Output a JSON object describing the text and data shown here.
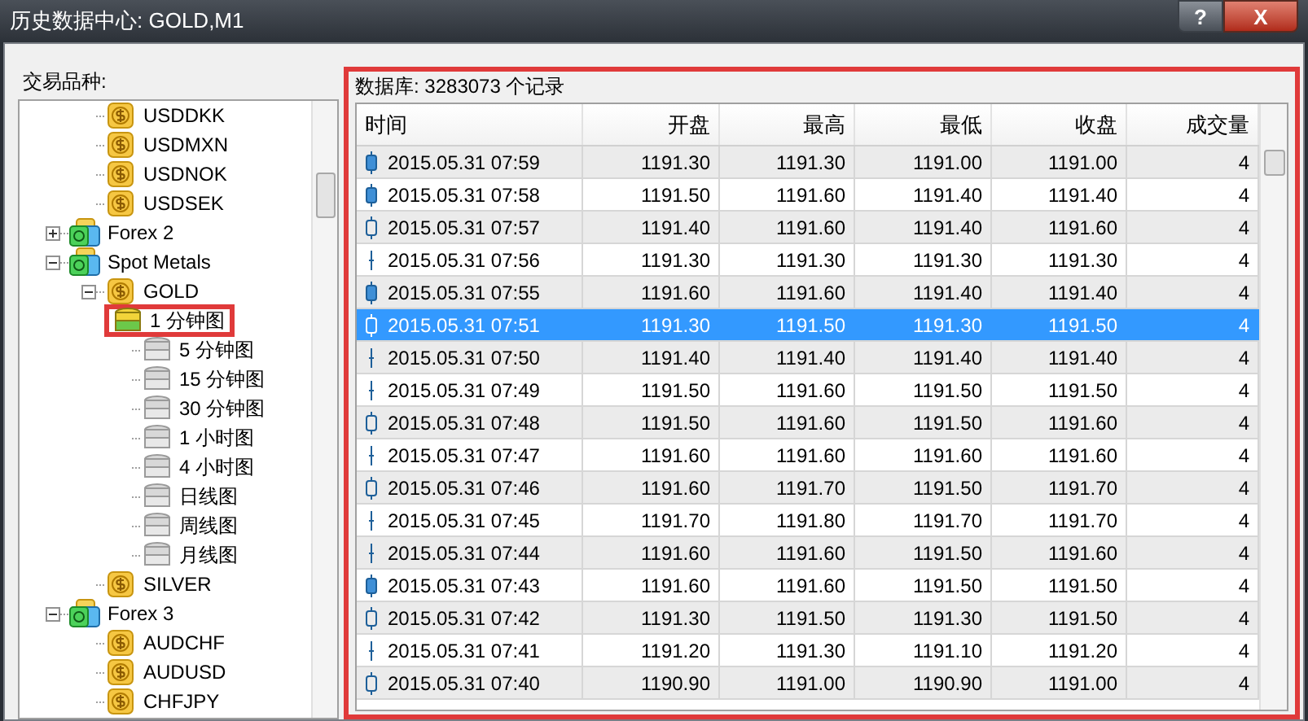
{
  "window": {
    "title": "历史数据中心: GOLD,M1",
    "buttons": [
      "?",
      "X"
    ]
  },
  "tree": {
    "label": "交易品种:",
    "continued_children": [
      {
        "kind": "symbol",
        "label": "USDDKK"
      },
      {
        "kind": "symbol",
        "label": "USDMXN"
      },
      {
        "kind": "symbol",
        "label": "USDNOK"
      },
      {
        "kind": "symbol",
        "label": "USDSEK"
      }
    ],
    "items": [
      {
        "kind": "group",
        "label": "Forex 2",
        "expanded": false
      },
      {
        "kind": "group",
        "label": "Spot Metals",
        "expanded": true,
        "children": [
          {
            "kind": "symbol",
            "label": "GOLD",
            "expanded": true,
            "children": [
              {
                "kind": "timeframe",
                "label": "1 分钟图",
                "selected": true,
                "annotated": true
              },
              {
                "kind": "timeframe",
                "label": "5 分钟图",
                "selected": false,
                "annotated": false
              },
              {
                "kind": "timeframe",
                "label": "15 分钟图",
                "selected": false,
                "annotated": false
              },
              {
                "kind": "timeframe",
                "label": "30 分钟图",
                "selected": false,
                "annotated": false
              },
              {
                "kind": "timeframe",
                "label": "1 小时图",
                "selected": false,
                "annotated": false
              },
              {
                "kind": "timeframe",
                "label": "4 小时图",
                "selected": false,
                "annotated": false
              },
              {
                "kind": "timeframe",
                "label": "日线图",
                "selected": false,
                "annotated": false
              },
              {
                "kind": "timeframe",
                "label": "周线图",
                "selected": false,
                "annotated": false
              },
              {
                "kind": "timeframe",
                "label": "月线图",
                "selected": false,
                "annotated": false
              }
            ]
          },
          {
            "kind": "symbol",
            "label": "SILVER"
          }
        ]
      },
      {
        "kind": "group",
        "label": "Forex 3",
        "expanded": true,
        "children": [
          {
            "kind": "symbol",
            "label": "AUDCHF"
          },
          {
            "kind": "symbol",
            "label": "AUDUSD"
          },
          {
            "kind": "symbol",
            "label": "CHFJPY"
          }
        ]
      }
    ]
  },
  "data_panel": {
    "annotated": true,
    "record_count": "数据库: 3283073 个记录",
    "columns": [
      "时间",
      "开盘",
      "最高",
      "最低",
      "收盘",
      "成交量"
    ],
    "rows": [
      {
        "kind": "bear",
        "selected": false,
        "cells": [
          "2015.05.31 07:59",
          "1191.30",
          "1191.30",
          "1191.00",
          "1191.00",
          "4"
        ]
      },
      {
        "kind": "bear",
        "selected": false,
        "cells": [
          "2015.05.31 07:58",
          "1191.50",
          "1191.60",
          "1191.40",
          "1191.40",
          "4"
        ]
      },
      {
        "kind": "bull",
        "selected": false,
        "cells": [
          "2015.05.31 07:57",
          "1191.40",
          "1191.60",
          "1191.40",
          "1191.60",
          "4"
        ]
      },
      {
        "kind": "doji",
        "selected": false,
        "cells": [
          "2015.05.31 07:56",
          "1191.30",
          "1191.30",
          "1191.30",
          "1191.30",
          "4"
        ]
      },
      {
        "kind": "bear",
        "selected": false,
        "cells": [
          "2015.05.31 07:55",
          "1191.60",
          "1191.60",
          "1191.40",
          "1191.40",
          "4"
        ]
      },
      {
        "kind": "bull",
        "selected": true,
        "cells": [
          "2015.05.31 07:51",
          "1191.30",
          "1191.50",
          "1191.30",
          "1191.50",
          "4"
        ]
      },
      {
        "kind": "doji",
        "selected": false,
        "cells": [
          "2015.05.31 07:50",
          "1191.40",
          "1191.40",
          "1191.40",
          "1191.40",
          "4"
        ]
      },
      {
        "kind": "doji",
        "selected": false,
        "cells": [
          "2015.05.31 07:49",
          "1191.50",
          "1191.60",
          "1191.50",
          "1191.50",
          "4"
        ]
      },
      {
        "kind": "bull",
        "selected": false,
        "cells": [
          "2015.05.31 07:48",
          "1191.50",
          "1191.60",
          "1191.50",
          "1191.60",
          "4"
        ]
      },
      {
        "kind": "doji",
        "selected": false,
        "cells": [
          "2015.05.31 07:47",
          "1191.60",
          "1191.60",
          "1191.60",
          "1191.60",
          "4"
        ]
      },
      {
        "kind": "bull",
        "selected": false,
        "cells": [
          "2015.05.31 07:46",
          "1191.60",
          "1191.70",
          "1191.50",
          "1191.70",
          "4"
        ]
      },
      {
        "kind": "doji",
        "selected": false,
        "cells": [
          "2015.05.31 07:45",
          "1191.70",
          "1191.80",
          "1191.70",
          "1191.70",
          "4"
        ]
      },
      {
        "kind": "doji",
        "selected": false,
        "cells": [
          "2015.05.31 07:44",
          "1191.60",
          "1191.60",
          "1191.50",
          "1191.60",
          "4"
        ]
      },
      {
        "kind": "bear",
        "selected": false,
        "cells": [
          "2015.05.31 07:43",
          "1191.60",
          "1191.60",
          "1191.50",
          "1191.50",
          "4"
        ]
      },
      {
        "kind": "bull",
        "selected": false,
        "cells": [
          "2015.05.31 07:42",
          "1191.30",
          "1191.50",
          "1191.30",
          "1191.50",
          "4"
        ]
      },
      {
        "kind": "doji",
        "selected": false,
        "cells": [
          "2015.05.31 07:41",
          "1191.20",
          "1191.30",
          "1191.10",
          "1191.20",
          "4"
        ]
      },
      {
        "kind": "bull",
        "selected": false,
        "cells": [
          "2015.05.31 07:40",
          "1190.90",
          "1191.00",
          "1190.90",
          "1191.00",
          "4"
        ]
      }
    ]
  }
}
